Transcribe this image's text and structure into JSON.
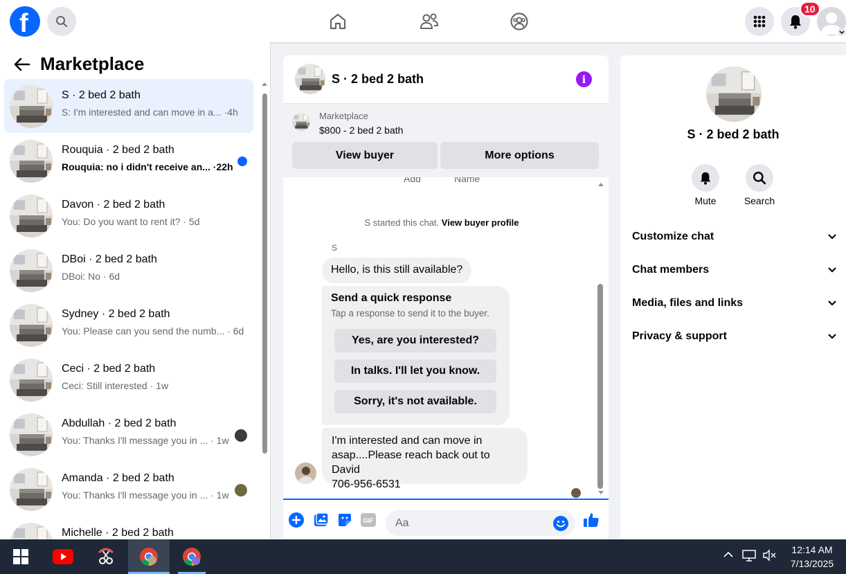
{
  "topbar": {
    "notifications_count": "10"
  },
  "sidebar": {
    "title": "Marketplace",
    "conversations": [
      {
        "name": "S · 2 bed 2 bath",
        "preview": "S: I'm interested and can move in a... ·4h",
        "active": true
      },
      {
        "name": "Rouquia · 2 bed 2 bath",
        "preview": "Rouquia: no i didn't receive an... ·22h",
        "unread": true
      },
      {
        "name": "Davon · 2 bed 2 bath",
        "preview": "You: Do you want to rent it? · 5d"
      },
      {
        "name": "DBoi · 2 bed 2 bath",
        "preview": "DBoi: No · 6d"
      },
      {
        "name": "Sydney · 2 bed 2 bath",
        "preview": "You: Please can you send the numb... · 6d"
      },
      {
        "name": "Ceci · 2 bed 2 bath",
        "preview": "Ceci: Still interested · 1w"
      },
      {
        "name": "Abdullah · 2 bed 2 bath",
        "preview": "You: Thanks I'll message you in ... · 1w"
      },
      {
        "name": "Amanda · 2 bed 2 bath",
        "preview": "You: Thanks I'll message you in ... · 1w"
      },
      {
        "name": "Michelle · 2 bed 2 bath",
        "preview": ""
      }
    ]
  },
  "chat": {
    "title": "S · 2 bed 2 bath",
    "listing_label": "Marketplace",
    "listing_price": "$800 - 2 bed 2 bath",
    "view_buyer": "View buyer",
    "more_options": "More options",
    "faded_add": "Add",
    "faded_name": "Name",
    "started_text": "S started this chat.",
    "view_profile": "View buyer profile",
    "sender": "S",
    "msg1": "Hello, is this still available?",
    "quick_title": "Send a quick response",
    "quick_sub": "Tap a response to send it to the buyer.",
    "quick_responses": [
      "Yes, are you interested?",
      "In talks. I'll let you know.",
      "Sorry, it's not available."
    ],
    "msg2_lines": [
      "I'm interested and can move in",
      "asap....Please reach back out to David",
      "706-956-6531"
    ],
    "input_placeholder": "Aa"
  },
  "info": {
    "name": "S · 2 bed 2 bath",
    "mute": "Mute",
    "search": "Search",
    "rows": [
      "Customize chat",
      "Chat members",
      "Media, files and links",
      "Privacy & support"
    ]
  },
  "taskbar": {
    "time": "12:14 AM",
    "date": "7/13/2025"
  },
  "colors": {
    "accent": "#0866ff",
    "info": "#9818f6",
    "badge": "#e41e3f"
  }
}
